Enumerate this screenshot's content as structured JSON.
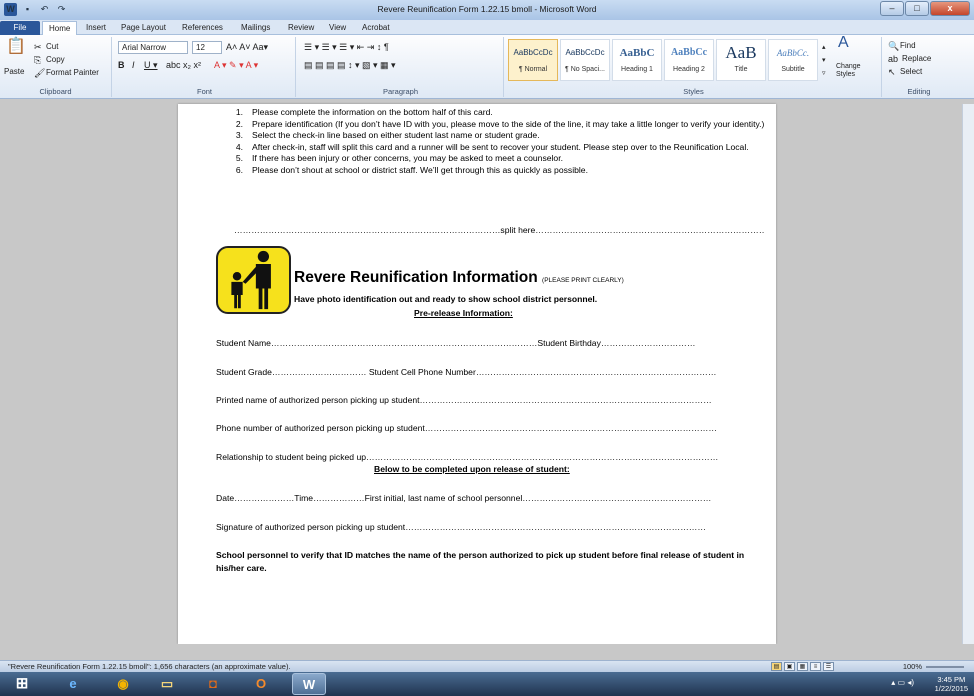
{
  "window": {
    "title": "Revere Reunification Form 1.22.15 bmoll  -  Microsoft Word",
    "minimize": "–",
    "maximize": "□",
    "close": "x"
  },
  "tabs": [
    "File",
    "Home",
    "Insert",
    "Page Layout",
    "References",
    "Mailings",
    "Review",
    "View",
    "Acrobat"
  ],
  "ribbon": {
    "clipboard": {
      "label": "Clipboard",
      "paste": "Paste",
      "cut": "Cut",
      "copy": "Copy",
      "format_painter": "Format Painter"
    },
    "font": {
      "label": "Font",
      "family": "Arial Narrow",
      "size": "12"
    },
    "paragraph": {
      "label": "Paragraph"
    },
    "styles": {
      "label": "Styles",
      "tiles": [
        {
          "preview": "AaBbCcDc",
          "name": "¶ Normal"
        },
        {
          "preview": "AaBbCcDc",
          "name": "¶ No Spaci..."
        },
        {
          "preview": "AaBbC",
          "name": "Heading 1"
        },
        {
          "preview": "AaBbCc",
          "name": "Heading 2"
        },
        {
          "preview": "AaB",
          "name": "Title"
        },
        {
          "preview": "AaBbCc.",
          "name": "Subtitle"
        }
      ],
      "change_styles": "Change Styles"
    },
    "editing": {
      "label": "Editing",
      "find": "Find",
      "replace": "Replace",
      "select": "Select"
    }
  },
  "document": {
    "instructions": [
      {
        "n": "1.",
        "text": "Please complete the information on the bottom half of this card."
      },
      {
        "n": "2.",
        "text": "Prepare identification (If you don’t have ID with you, please move to the side of the line, it may take a little longer to verify your identity.)"
      },
      {
        "n": "3.",
        "text": "Select the check-in line based on either student last name or student grade."
      },
      {
        "n": "4.",
        "text": "After check-in, staff will split this card and a runner will be sent to recover your student.  Please step over to the Reunification Local."
      },
      {
        "n": "5.",
        "text": "If there has been injury or other concerns, you may be asked to meet a counselor."
      },
      {
        "n": "6.",
        "text": "Please don’t shout at school or district staff.  We’ll get through this as quickly as possible."
      }
    ],
    "split_line": "…………………………………………………………………………………split here………………………………………………………………………………",
    "heading": "Revere Reunification Information",
    "heading_note": "(PLEASE PRINT CLEARLY)",
    "subheading": "Have photo identification out and ready to show school district personnel.",
    "pre_release": "Pre-release Information:",
    "fields": [
      "Student Name…………………………………………………………………………………Student  Birthday……………………………",
      "Student Grade……………………………  Student Cell Phone Number…………………………………………………………………………",
      "Printed name of authorized person picking up student…………………………………………………………………………………………",
      "Phone number of authorized person picking up student…………………………………………………………………………………………",
      "Relationship to student being picked up……………………………………………………………………………………………………………"
    ],
    "release_heading": "Below to be completed upon release of student:",
    "release_fields": [
      "Date…………………Time………………First initial, last name of school personnel…………………………………………………………",
      "Signature of authorized person picking up student……………………………………………………………………………………………"
    ],
    "note": "School personnel to verify that ID matches the name of the person authorized to pick up student before final release of student in his/her care."
  },
  "status": {
    "text": "\"Revere Reunification Form 1.22.15 bmoll\": 1,656 characters (an approximate value).",
    "zoom": "100%"
  },
  "taskbar": {
    "time": "3:45 PM",
    "date": "1/22/2015"
  }
}
